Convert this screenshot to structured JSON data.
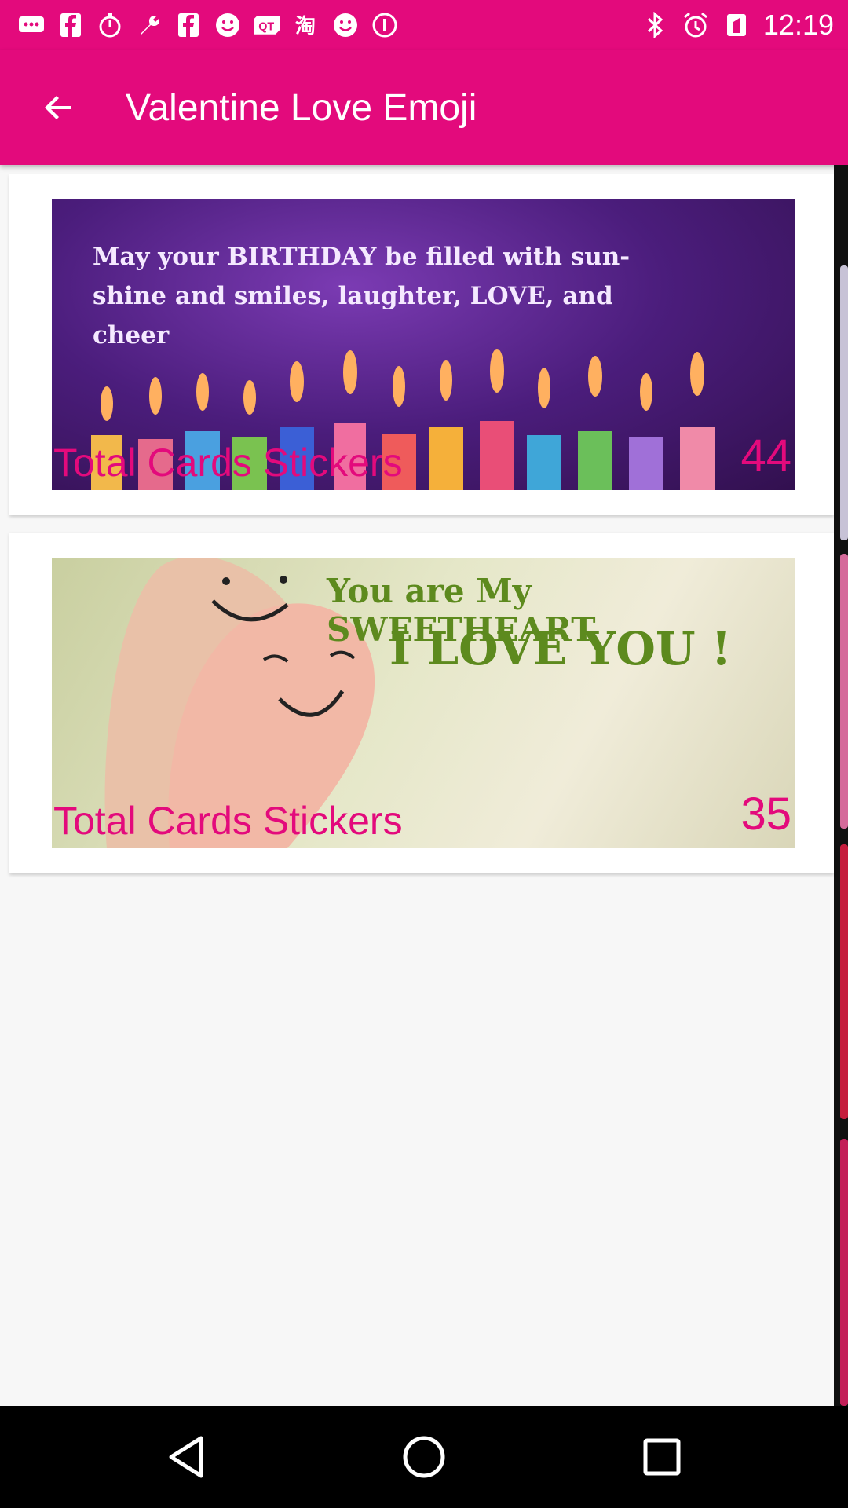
{
  "status_bar": {
    "time": "12:19",
    "icons": [
      "chat-icon",
      "facebook-icon",
      "timer-icon",
      "wrench-icon",
      "facebook-icon",
      "smiley-icon",
      "qt-icon",
      "hashtag-icon",
      "smiley-icon",
      "info-icon",
      "bluetooth-icon",
      "alarm-icon",
      "signal-icon"
    ]
  },
  "app_bar": {
    "title": "Valentine Love Emoji"
  },
  "cards": [
    {
      "image_text": "May your BIRTHDAY be filled with sun- shine and smiles, laughter, LOVE, and cheer",
      "label": "Total Cards Stickers",
      "count": "44"
    },
    {
      "image_text_line1": "You are My SWEETHEART",
      "image_text_line2": "I LOVE YOU !",
      "label": "Total Cards Stickers",
      "count": "35"
    }
  ],
  "colors": {
    "accent": "#e30a7c",
    "background": "#f7f7f7"
  }
}
